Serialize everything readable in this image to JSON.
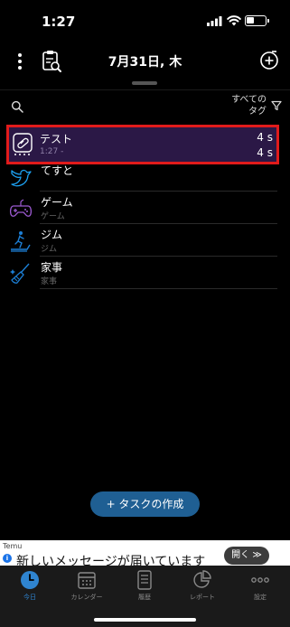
{
  "status_bar": {
    "time": "1:27"
  },
  "header": {
    "date": "7月31日, 木"
  },
  "filter": {
    "label_line1": "すべての",
    "label_line2": "タグ"
  },
  "tasks": [
    {
      "name": "テスト",
      "subtitle": "1:27 -",
      "duration_1": "4 s",
      "duration_2": "4 s",
      "icon": "test-tube-icon",
      "active": true,
      "highlight_color": "#e11b1b"
    },
    {
      "name": "てすと",
      "subtitle": "",
      "icon": "bird-icon",
      "icon_color": "#1da1f2"
    },
    {
      "name": "ゲーム",
      "subtitle": "ゲーム",
      "icon": "gamepad-icon",
      "icon_color": "#9b59d0"
    },
    {
      "name": "ジム",
      "subtitle": "ジム",
      "icon": "treadmill-icon",
      "icon_color": "#1c7fd6"
    },
    {
      "name": "家事",
      "subtitle": "家事",
      "icon": "broom-icon",
      "icon_color": "#1c7fd6"
    }
  ],
  "create_button": {
    "label": "+ タスクの作成"
  },
  "ad": {
    "brand": "Temu",
    "text": "新しいメッセージが届いています",
    "open_label": "開く ≫"
  },
  "tabs": [
    {
      "label": "今日",
      "icon": "clock-icon",
      "active": true
    },
    {
      "label": "カレンダー",
      "icon": "calendar-icon"
    },
    {
      "label": "履歴",
      "icon": "history-icon"
    },
    {
      "label": "レポート",
      "icon": "pie-chart-icon"
    },
    {
      "label": "設定",
      "icon": "more-icon"
    }
  ],
  "colors": {
    "accent": "#1f5f93",
    "active_tab": "#2f84d0",
    "active_row_bg": "#2b1846"
  }
}
